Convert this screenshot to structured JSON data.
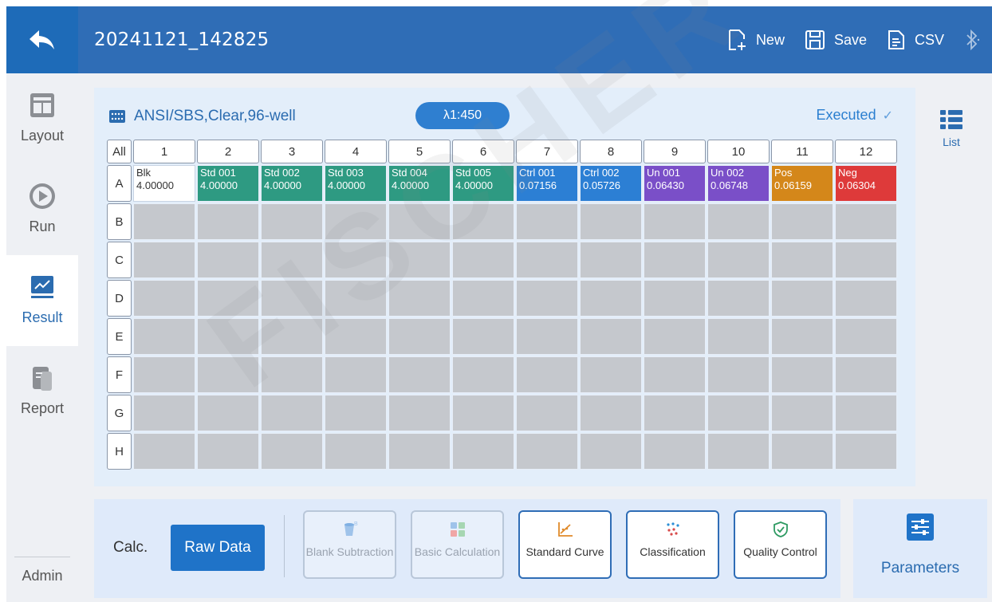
{
  "header": {
    "title": "20241121_142825",
    "actions": [
      {
        "label": "New",
        "icon": "new-file-icon"
      },
      {
        "label": "Save",
        "icon": "save-icon"
      },
      {
        "label": "CSV",
        "icon": "csv-file-icon"
      }
    ]
  },
  "sidebar": {
    "items": [
      {
        "label": "Layout",
        "icon": "layout-icon"
      },
      {
        "label": "Run",
        "icon": "play-icon"
      },
      {
        "label": "Result",
        "icon": "chart-icon",
        "active": true
      },
      {
        "label": "Report",
        "icon": "report-icon"
      }
    ],
    "admin": "Admin"
  },
  "plate": {
    "type": "ANSI/SBS,Clear,96-well",
    "wavelength": "λ1:450",
    "status": "Executed",
    "all_label": "All",
    "columns": [
      "1",
      "2",
      "3",
      "4",
      "5",
      "6",
      "7",
      "8",
      "9",
      "10",
      "11",
      "12"
    ],
    "rows": [
      "A",
      "B",
      "C",
      "D",
      "E",
      "F",
      "G",
      "H"
    ],
    "wells_row_a": [
      {
        "name": "Blk",
        "value": "4.00000",
        "color": "#ffffff"
      },
      {
        "name": "Std 001",
        "value": "4.00000",
        "color": "#2e9a82"
      },
      {
        "name": "Std 002",
        "value": "4.00000",
        "color": "#2e9a82"
      },
      {
        "name": "Std 003",
        "value": "4.00000",
        "color": "#2e9a82"
      },
      {
        "name": "Std 004",
        "value": "4.00000",
        "color": "#2e9a82"
      },
      {
        "name": "Std 005",
        "value": "4.00000",
        "color": "#2e9a82"
      },
      {
        "name": "Ctrl 001",
        "value": "0.07156",
        "color": "#2c7fd4"
      },
      {
        "name": "Ctrl 002",
        "value": "0.05726",
        "color": "#2c7fd4"
      },
      {
        "name": "Un 001",
        "value": "0.06430",
        "color": "#7a4fc8"
      },
      {
        "name": "Un 002",
        "value": "0.06748",
        "color": "#7a4fc8"
      },
      {
        "name": "Pos",
        "value": "0.06159",
        "color": "#d4871a"
      },
      {
        "name": "Neg",
        "value": "0.06304",
        "color": "#de3a3a"
      }
    ]
  },
  "list_button": {
    "label": "List"
  },
  "calc": {
    "label": "Calc.",
    "raw_data": "Raw Data",
    "buttons": [
      {
        "label": "Blank Subtraction",
        "enabled": false
      },
      {
        "label": "Basic Calculation",
        "enabled": false
      },
      {
        "label": "Standard Curve",
        "enabled": true
      },
      {
        "label": "Classification",
        "enabled": true
      },
      {
        "label": "Quality Control",
        "enabled": true
      }
    ]
  },
  "parameters": {
    "label": "Parameters"
  },
  "watermark": "FISCHER SAS"
}
